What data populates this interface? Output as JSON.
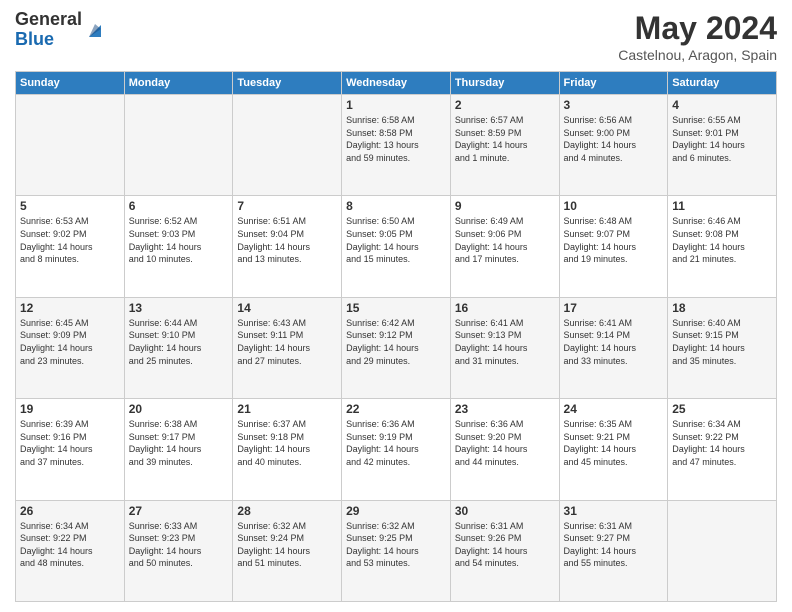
{
  "logo": {
    "general": "General",
    "blue": "Blue"
  },
  "title": "May 2024",
  "location": "Castelnou, Aragon, Spain",
  "days_of_week": [
    "Sunday",
    "Monday",
    "Tuesday",
    "Wednesday",
    "Thursday",
    "Friday",
    "Saturday"
  ],
  "weeks": [
    [
      {
        "day": "",
        "content": ""
      },
      {
        "day": "",
        "content": ""
      },
      {
        "day": "",
        "content": ""
      },
      {
        "day": "1",
        "content": "Sunrise: 6:58 AM\nSunset: 8:58 PM\nDaylight: 13 hours\nand 59 minutes."
      },
      {
        "day": "2",
        "content": "Sunrise: 6:57 AM\nSunset: 8:59 PM\nDaylight: 14 hours\nand 1 minute."
      },
      {
        "day": "3",
        "content": "Sunrise: 6:56 AM\nSunset: 9:00 PM\nDaylight: 14 hours\nand 4 minutes."
      },
      {
        "day": "4",
        "content": "Sunrise: 6:55 AM\nSunset: 9:01 PM\nDaylight: 14 hours\nand 6 minutes."
      }
    ],
    [
      {
        "day": "5",
        "content": "Sunrise: 6:53 AM\nSunset: 9:02 PM\nDaylight: 14 hours\nand 8 minutes."
      },
      {
        "day": "6",
        "content": "Sunrise: 6:52 AM\nSunset: 9:03 PM\nDaylight: 14 hours\nand 10 minutes."
      },
      {
        "day": "7",
        "content": "Sunrise: 6:51 AM\nSunset: 9:04 PM\nDaylight: 14 hours\nand 13 minutes."
      },
      {
        "day": "8",
        "content": "Sunrise: 6:50 AM\nSunset: 9:05 PM\nDaylight: 14 hours\nand 15 minutes."
      },
      {
        "day": "9",
        "content": "Sunrise: 6:49 AM\nSunset: 9:06 PM\nDaylight: 14 hours\nand 17 minutes."
      },
      {
        "day": "10",
        "content": "Sunrise: 6:48 AM\nSunset: 9:07 PM\nDaylight: 14 hours\nand 19 minutes."
      },
      {
        "day": "11",
        "content": "Sunrise: 6:46 AM\nSunset: 9:08 PM\nDaylight: 14 hours\nand 21 minutes."
      }
    ],
    [
      {
        "day": "12",
        "content": "Sunrise: 6:45 AM\nSunset: 9:09 PM\nDaylight: 14 hours\nand 23 minutes."
      },
      {
        "day": "13",
        "content": "Sunrise: 6:44 AM\nSunset: 9:10 PM\nDaylight: 14 hours\nand 25 minutes."
      },
      {
        "day": "14",
        "content": "Sunrise: 6:43 AM\nSunset: 9:11 PM\nDaylight: 14 hours\nand 27 minutes."
      },
      {
        "day": "15",
        "content": "Sunrise: 6:42 AM\nSunset: 9:12 PM\nDaylight: 14 hours\nand 29 minutes."
      },
      {
        "day": "16",
        "content": "Sunrise: 6:41 AM\nSunset: 9:13 PM\nDaylight: 14 hours\nand 31 minutes."
      },
      {
        "day": "17",
        "content": "Sunrise: 6:41 AM\nSunset: 9:14 PM\nDaylight: 14 hours\nand 33 minutes."
      },
      {
        "day": "18",
        "content": "Sunrise: 6:40 AM\nSunset: 9:15 PM\nDaylight: 14 hours\nand 35 minutes."
      }
    ],
    [
      {
        "day": "19",
        "content": "Sunrise: 6:39 AM\nSunset: 9:16 PM\nDaylight: 14 hours\nand 37 minutes."
      },
      {
        "day": "20",
        "content": "Sunrise: 6:38 AM\nSunset: 9:17 PM\nDaylight: 14 hours\nand 39 minutes."
      },
      {
        "day": "21",
        "content": "Sunrise: 6:37 AM\nSunset: 9:18 PM\nDaylight: 14 hours\nand 40 minutes."
      },
      {
        "day": "22",
        "content": "Sunrise: 6:36 AM\nSunset: 9:19 PM\nDaylight: 14 hours\nand 42 minutes."
      },
      {
        "day": "23",
        "content": "Sunrise: 6:36 AM\nSunset: 9:20 PM\nDaylight: 14 hours\nand 44 minutes."
      },
      {
        "day": "24",
        "content": "Sunrise: 6:35 AM\nSunset: 9:21 PM\nDaylight: 14 hours\nand 45 minutes."
      },
      {
        "day": "25",
        "content": "Sunrise: 6:34 AM\nSunset: 9:22 PM\nDaylight: 14 hours\nand 47 minutes."
      }
    ],
    [
      {
        "day": "26",
        "content": "Sunrise: 6:34 AM\nSunset: 9:22 PM\nDaylight: 14 hours\nand 48 minutes."
      },
      {
        "day": "27",
        "content": "Sunrise: 6:33 AM\nSunset: 9:23 PM\nDaylight: 14 hours\nand 50 minutes."
      },
      {
        "day": "28",
        "content": "Sunrise: 6:32 AM\nSunset: 9:24 PM\nDaylight: 14 hours\nand 51 minutes."
      },
      {
        "day": "29",
        "content": "Sunrise: 6:32 AM\nSunset: 9:25 PM\nDaylight: 14 hours\nand 53 minutes."
      },
      {
        "day": "30",
        "content": "Sunrise: 6:31 AM\nSunset: 9:26 PM\nDaylight: 14 hours\nand 54 minutes."
      },
      {
        "day": "31",
        "content": "Sunrise: 6:31 AM\nSunset: 9:27 PM\nDaylight: 14 hours\nand 55 minutes."
      },
      {
        "day": "",
        "content": ""
      }
    ]
  ]
}
